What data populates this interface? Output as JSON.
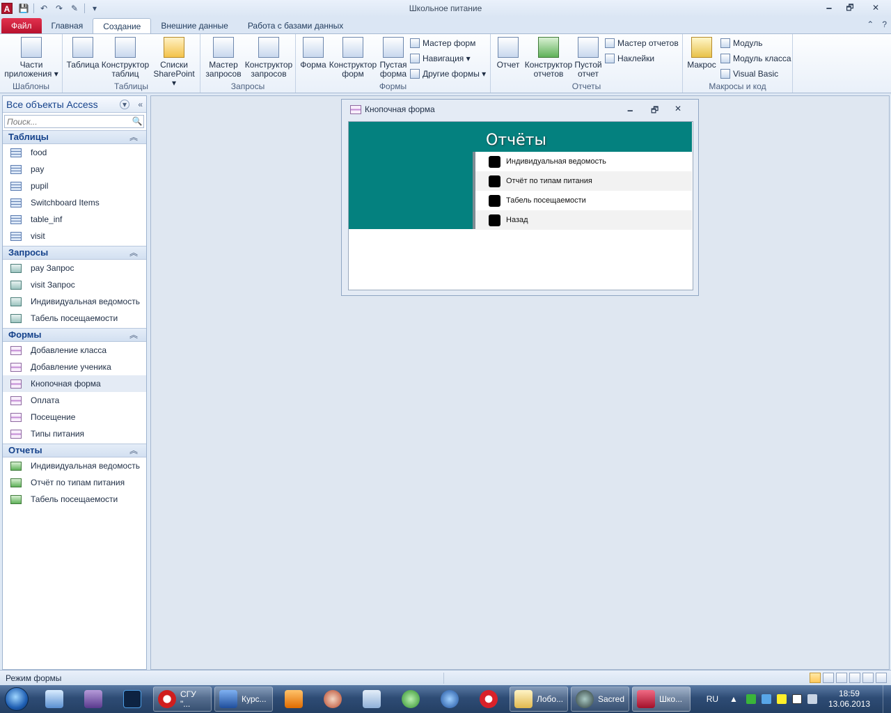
{
  "app": {
    "icon_letter": "A",
    "window_title": "Школьное питание"
  },
  "window_controls": {
    "minimize": "🗕",
    "restore": "🗗",
    "close": "✕"
  },
  "tabs": [
    {
      "label": "Файл"
    },
    {
      "label": "Главная"
    },
    {
      "label": "Создание"
    },
    {
      "label": "Внешние данные"
    },
    {
      "label": "Работа с базами данных"
    }
  ],
  "ribbon": {
    "groups": {
      "templates": {
        "label": "Шаблоны",
        "buttons": {
          "app_parts": "Части приложения ▾"
        }
      },
      "tables": {
        "label": "Таблицы",
        "buttons": {
          "table": "Таблица",
          "table_designer": "Конструктор таблиц",
          "sharepoint": "Списки SharePoint ▾"
        }
      },
      "queries": {
        "label": "Запросы",
        "buttons": {
          "query_wizard": "Мастер запросов",
          "query_designer": "Конструктор запросов"
        }
      },
      "forms": {
        "label": "Формы",
        "buttons": {
          "form": "Форма",
          "form_designer": "Конструктор форм",
          "blank_form": "Пустая форма",
          "form_wizard": "Мастер форм",
          "navigation": "Навигация ▾",
          "more_forms": "Другие формы ▾"
        }
      },
      "reports": {
        "label": "Отчеты",
        "buttons": {
          "report": "Отчет",
          "report_designer": "Конструктор отчетов",
          "blank_report": "Пустой отчет",
          "report_wizard": "Мастер отчетов",
          "labels": "Наклейки"
        }
      },
      "macros": {
        "label": "Макросы и код",
        "buttons": {
          "macro": "Макрос",
          "module": "Модуль",
          "class_module": "Модуль класса",
          "visual_basic": "Visual Basic"
        }
      }
    }
  },
  "nav": {
    "header": "Все объекты Access",
    "search_placeholder": "Поиск...",
    "sections": {
      "tables": {
        "title": "Таблицы",
        "items": [
          "food",
          "pay",
          "pupil",
          "Switchboard Items",
          "table_inf",
          "visit"
        ]
      },
      "queries": {
        "title": "Запросы",
        "items": [
          "pay Запрос",
          "visit Запрос",
          "Индивидуальная ведомость",
          "Табель посещаемости"
        ]
      },
      "forms": {
        "title": "Формы",
        "items": [
          "Добавление класса",
          "Добавление ученика",
          "Кнопочная форма",
          "Оплата",
          "Посещение",
          "Типы питания"
        ]
      },
      "reports": {
        "title": "Отчеты",
        "items": [
          "Индивидуальная ведомость",
          "Отчёт по типам питания",
          "Табель посещаемости"
        ]
      }
    }
  },
  "form_window": {
    "title": "Кнопочная форма",
    "heading": "Отчёты",
    "items": [
      "Индивидуальная ведомость",
      "Отчёт по типам питания",
      "Табель посещаемости",
      "Назад"
    ],
    "colors": {
      "header": "#04817f"
    }
  },
  "status": {
    "mode": "Режим формы"
  },
  "taskbar": {
    "windows": [
      "СГУ \"...",
      "Курс...",
      "Лобо...",
      "Sacred",
      "Шко..."
    ],
    "lang": "RU",
    "time": "18:59",
    "date": "13.06.2013"
  }
}
